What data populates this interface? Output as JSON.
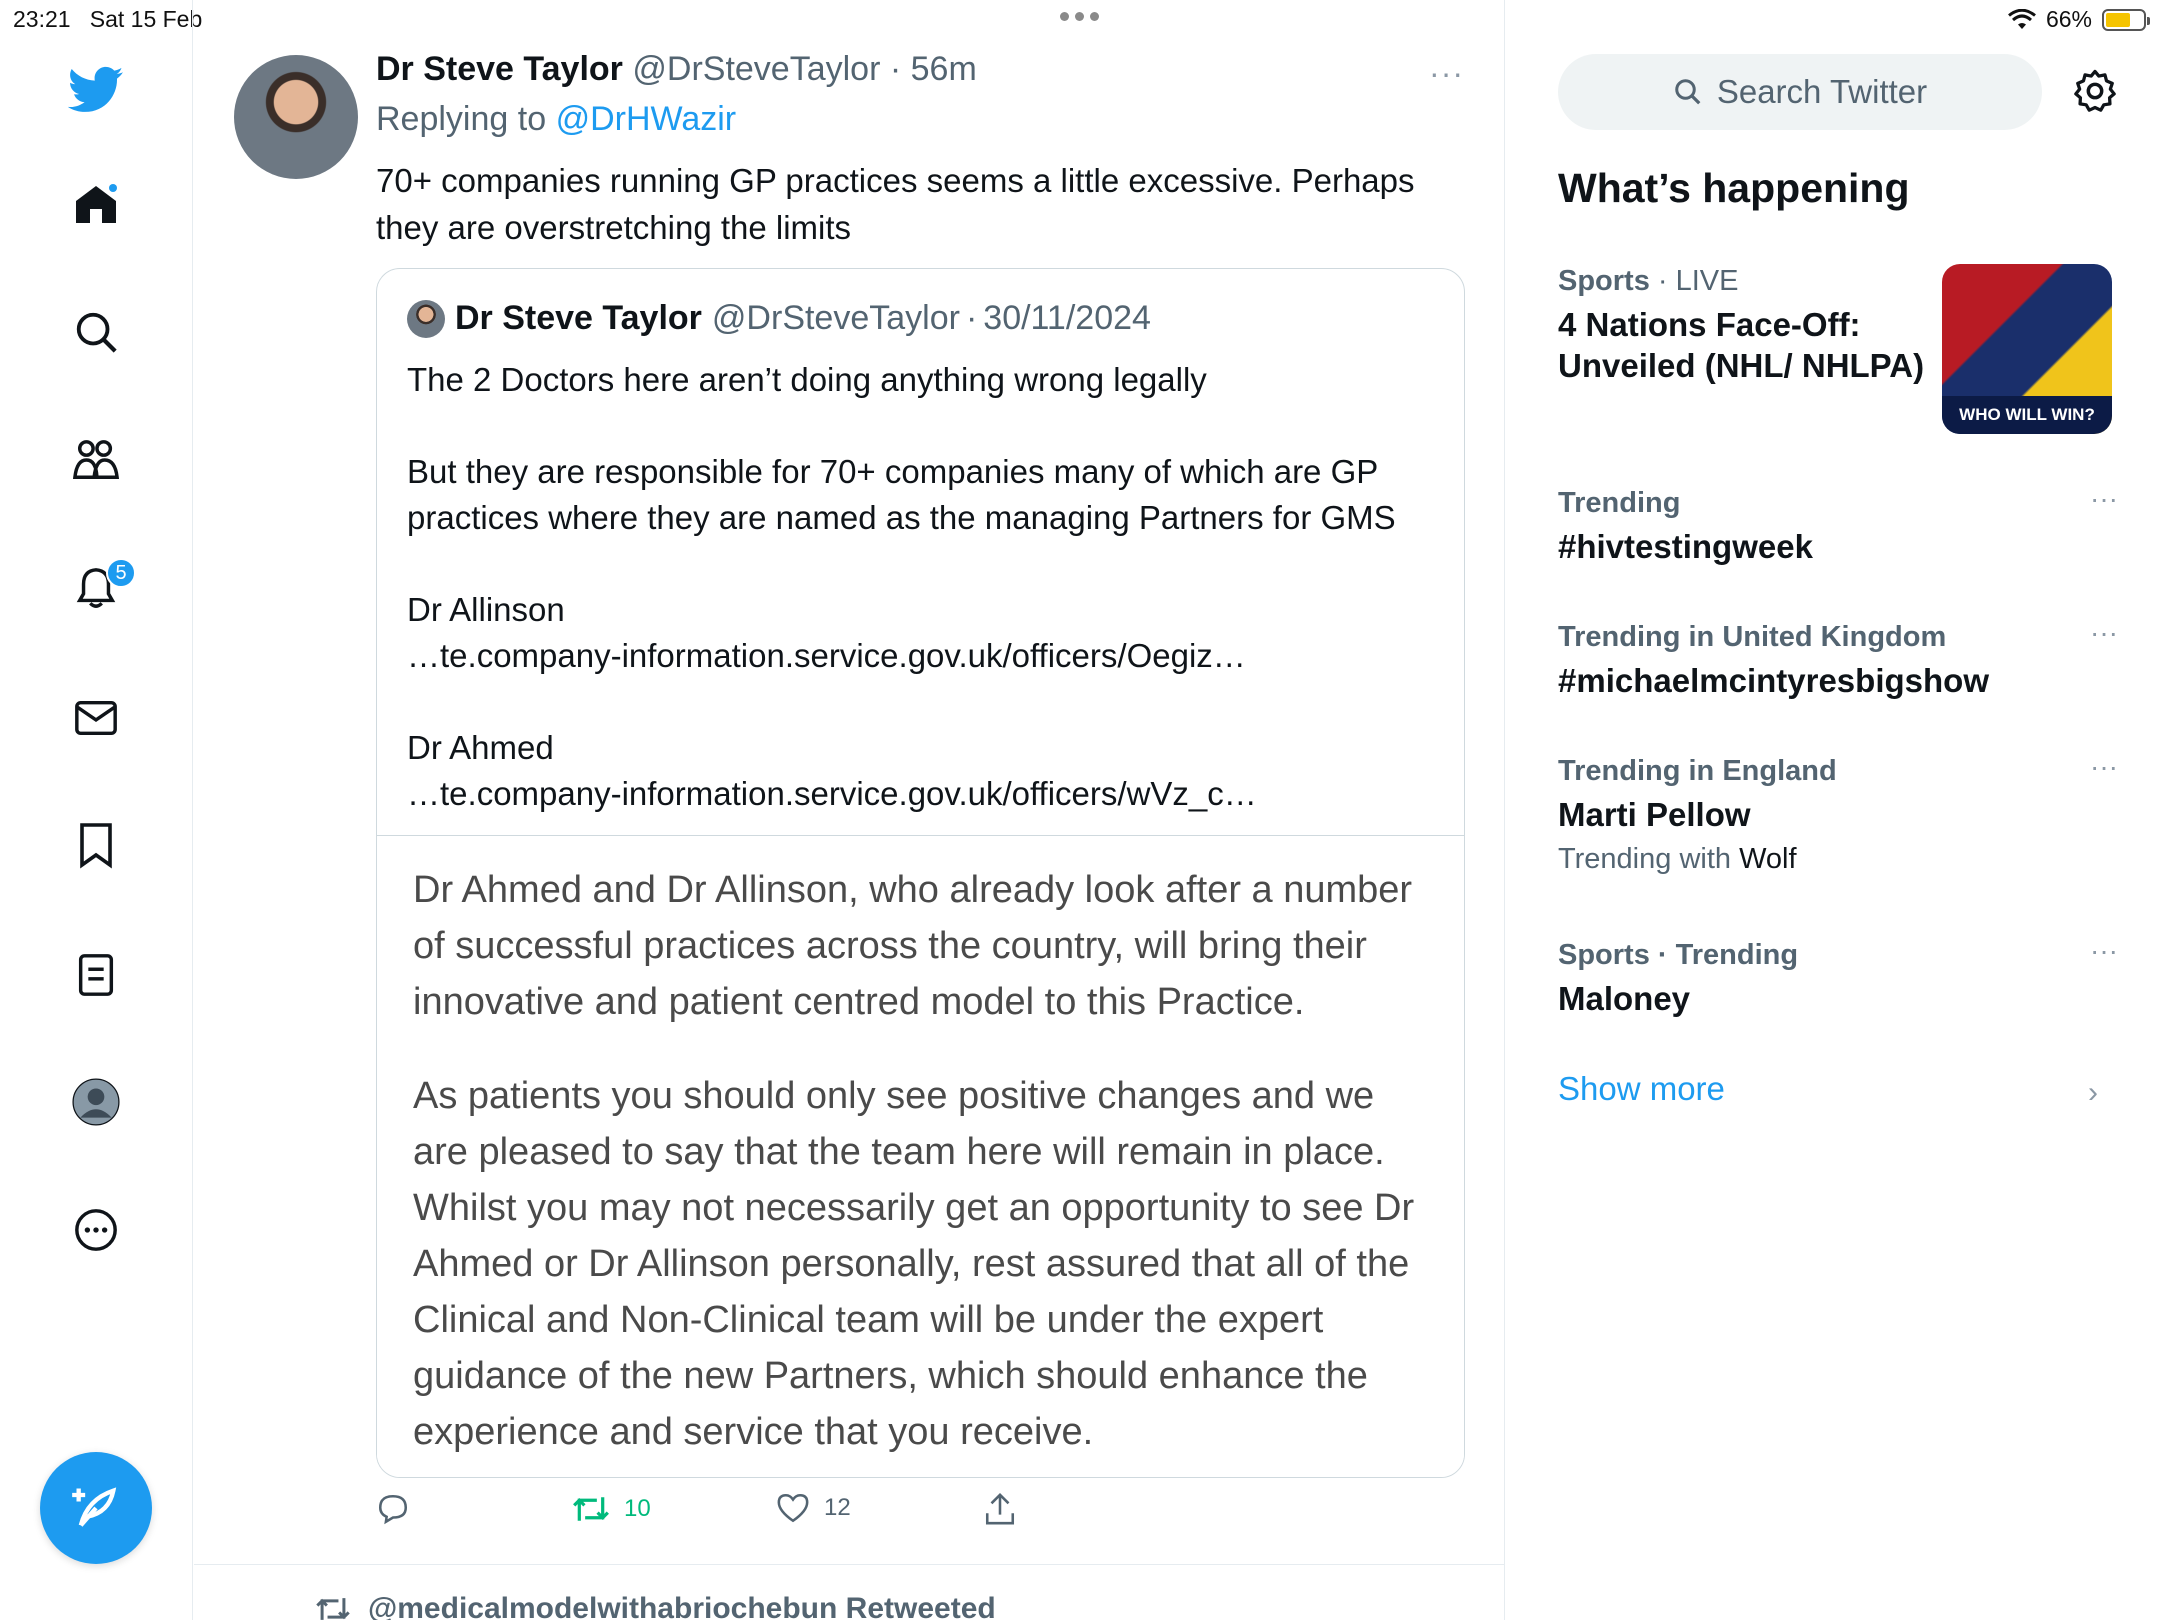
{
  "status": {
    "time": "23:21",
    "date": "Sat 15 Feb",
    "battery": "66%",
    "battery_level": 0.66
  },
  "nav": {
    "notification_count": "5",
    "items": [
      "home-icon",
      "search-icon",
      "communities-icon",
      "notifications-icon",
      "messages-icon",
      "bookmarks-icon",
      "lists-icon",
      "profile-icon",
      "more-icon"
    ]
  },
  "tweet": {
    "name": "Dr Steve Taylor",
    "handle": "@DrSteveTaylor",
    "time": "56m",
    "replying_prefix": "Replying to",
    "replying_to": "@DrHWazir",
    "text": "70+ companies running GP practices seems a little excessive. Perhaps they are overstretching the limits",
    "quote": {
      "name": "Dr Steve Taylor",
      "handle": "@DrSteveTaylor",
      "date": "30/11/2024",
      "line1": "The 2 Doctors here aren’t doing anything wrong legally",
      "line2": "But they are responsible for 70+ companies many of which are GP practices where they are named as the managing Partners for GMS",
      "line3": "Dr Allinson",
      "line4": "…te.company-information.service.gov.uk/officers/Oegiz…",
      "line5": "Dr Ahmed",
      "line6": "…te.company-information.service.gov.uk/officers/wVz_c…",
      "image_para1": "Dr Ahmed and Dr Allinson, who already look after a number of successful practices across the country, will bring their innovative and patient centred model to this Practice.",
      "image_para2": "As patients you should only see positive changes and we are pleased to say that the team here will remain in place. Whilst you may not necessarily get an opportunity to see Dr Ahmed or Dr Allinson personally, rest assured that all of the Clinical and Non-Clinical team will be under the expert guidance of the new Partners, which should enhance the experience and service that you receive."
    },
    "retweets": "10",
    "likes": "12"
  },
  "next_item": {
    "retweeted_by": "@medicalmodelwithabriochebun Retweeted"
  },
  "sidebar": {
    "search_placeholder": "Search Twitter",
    "heading": "What’s happening",
    "trends": [
      {
        "category": "Sports",
        "context": "LIVE",
        "title": "4 Nations Face-Off: Unveiled (NHL/ NHLPA)",
        "image_caption": "WHO WILL WIN?"
      },
      {
        "category": "Trending",
        "title": "#hivtestingweek"
      },
      {
        "category": "Trending in United Kingdom",
        "title": "#michaelmcintyresbigshow"
      },
      {
        "category": "Trending in England",
        "title": "Marti Pellow",
        "with_label": "Trending with",
        "with_value": "Wolf"
      },
      {
        "category": "Sports · Trending",
        "title": "Maloney"
      }
    ],
    "show_more": "Show more"
  },
  "colors": {
    "accent": "#1d9bf0",
    "retweet_green": "#00ba7c",
    "secondary_text": "#536471"
  }
}
